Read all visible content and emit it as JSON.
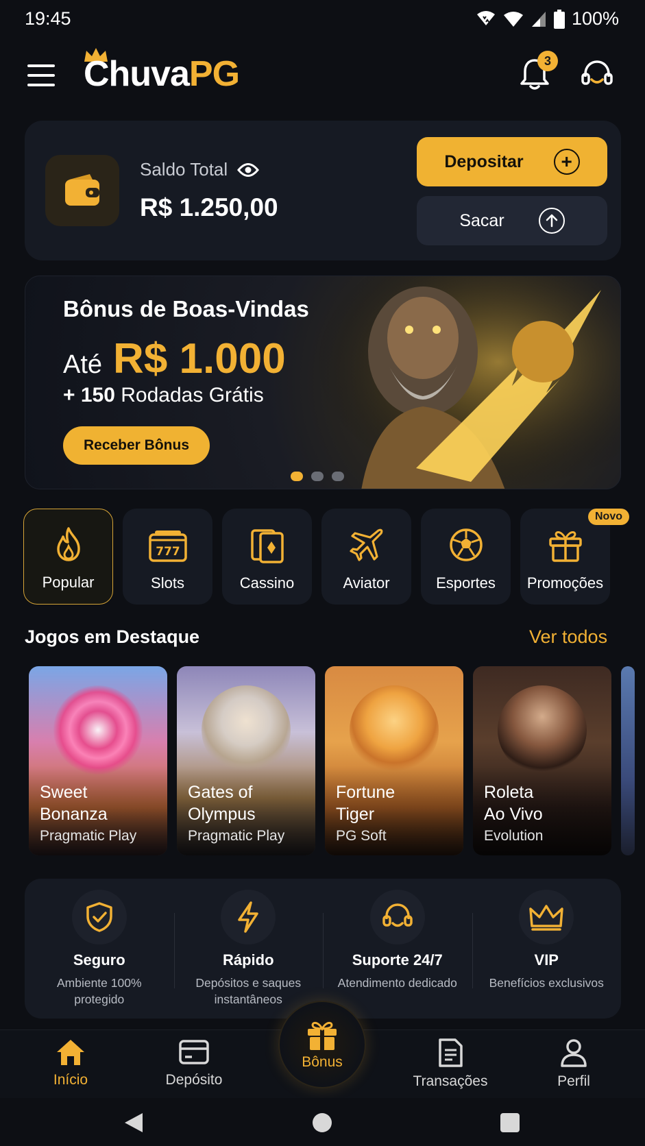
{
  "status_bar": {
    "time": "19:45",
    "battery": "100%"
  },
  "header": {
    "logo_part1": "Chuva",
    "logo_part2": "PG",
    "notifications_count": "3"
  },
  "balance": {
    "label": "Saldo Total",
    "value": "R$ 1.250,00",
    "deposit_label": "Depositar",
    "withdraw_label": "Sacar"
  },
  "banner": {
    "title": "Bônus de Boas-Vindas",
    "ate": "Até",
    "amount": "R$ 1.000",
    "plus_150": "+ 150",
    "rodadas": "Rodadas Grátis",
    "cta": "Receber Bônus",
    "active_slide": 1,
    "slide_count": 3
  },
  "categories": [
    {
      "label": "Popular",
      "icon": "fire-icon"
    },
    {
      "label": "Slots",
      "icon": "slot-machine-icon"
    },
    {
      "label": "Cassino",
      "icon": "cards-icon"
    },
    {
      "label": "Aviator",
      "icon": "airplane-icon"
    },
    {
      "label": "Esportes",
      "icon": "soccer-ball-icon"
    },
    {
      "label": "Promoções",
      "icon": "gift-icon"
    }
  ],
  "novo_badge": "Novo",
  "featured": {
    "title": "Jogos em Destaque",
    "see_all": "Ver todos",
    "games": [
      {
        "name_line1": "Sweet",
        "name_line2": "Bonanza",
        "provider": "Pragmatic Play"
      },
      {
        "name_line1": "Gates of",
        "name_line2": "Olympus",
        "provider": "Pragmatic Play"
      },
      {
        "name_line1": "Fortune",
        "name_line2": "Tiger",
        "provider": "PG Soft"
      },
      {
        "name_line1": "Roleta",
        "name_line2": "Ao Vivo",
        "provider": "Evolution"
      }
    ]
  },
  "features": [
    {
      "name": "Seguro",
      "desc": "Ambiente 100% protegido",
      "icon": "shield-check-icon"
    },
    {
      "name": "Rápido",
      "desc": "Depósitos e saques instantâneos",
      "icon": "lightning-icon"
    },
    {
      "name": "Suporte 24/7",
      "desc": "Atendimento dedicado",
      "icon": "headset-icon"
    },
    {
      "name": "VIP",
      "desc": "Benefícios exclusivos",
      "icon": "crown-icon"
    }
  ],
  "bottom_nav": {
    "inicio": "Início",
    "deposito": "Depósito",
    "bonus": "Bônus",
    "transacoes": "Transações",
    "perfil": "Perfil"
  },
  "colors": {
    "accent": "#f2b134",
    "background": "#0d0f14",
    "card": "#161a23"
  }
}
